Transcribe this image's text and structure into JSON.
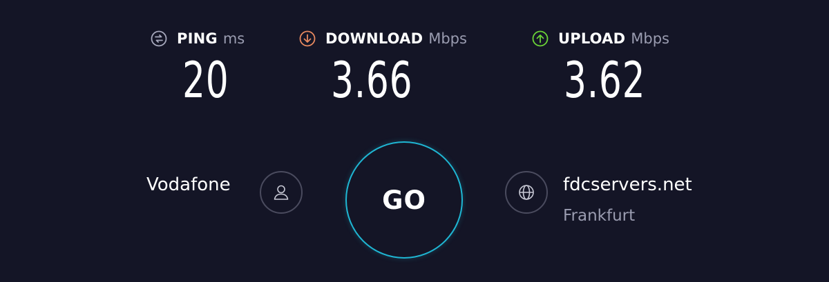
{
  "metrics": {
    "ping": {
      "label": "PING",
      "unit": "ms",
      "value": "20",
      "icon": "ping-icon",
      "icon_color": "#a7a9bd"
    },
    "download": {
      "label": "DOWNLOAD",
      "unit": "Mbps",
      "value": "3.66",
      "icon": "download-arrow-icon",
      "icon_color": "#e8895f"
    },
    "upload": {
      "label": "UPLOAD",
      "unit": "Mbps",
      "value": "3.62",
      "icon": "upload-arrow-icon",
      "icon_color": "#6bd437"
    }
  },
  "provider": {
    "name": "Vodafone",
    "icon": "user-icon"
  },
  "go_button": {
    "label": "GO",
    "ring_color": "#1fb6d3"
  },
  "server": {
    "name": "fdcservers.net",
    "location": "Frankfurt",
    "icon": "globe-icon"
  },
  "colors": {
    "background": "#141526",
    "muted_text": "#9a9cb0",
    "border": "#4a4b5e"
  }
}
